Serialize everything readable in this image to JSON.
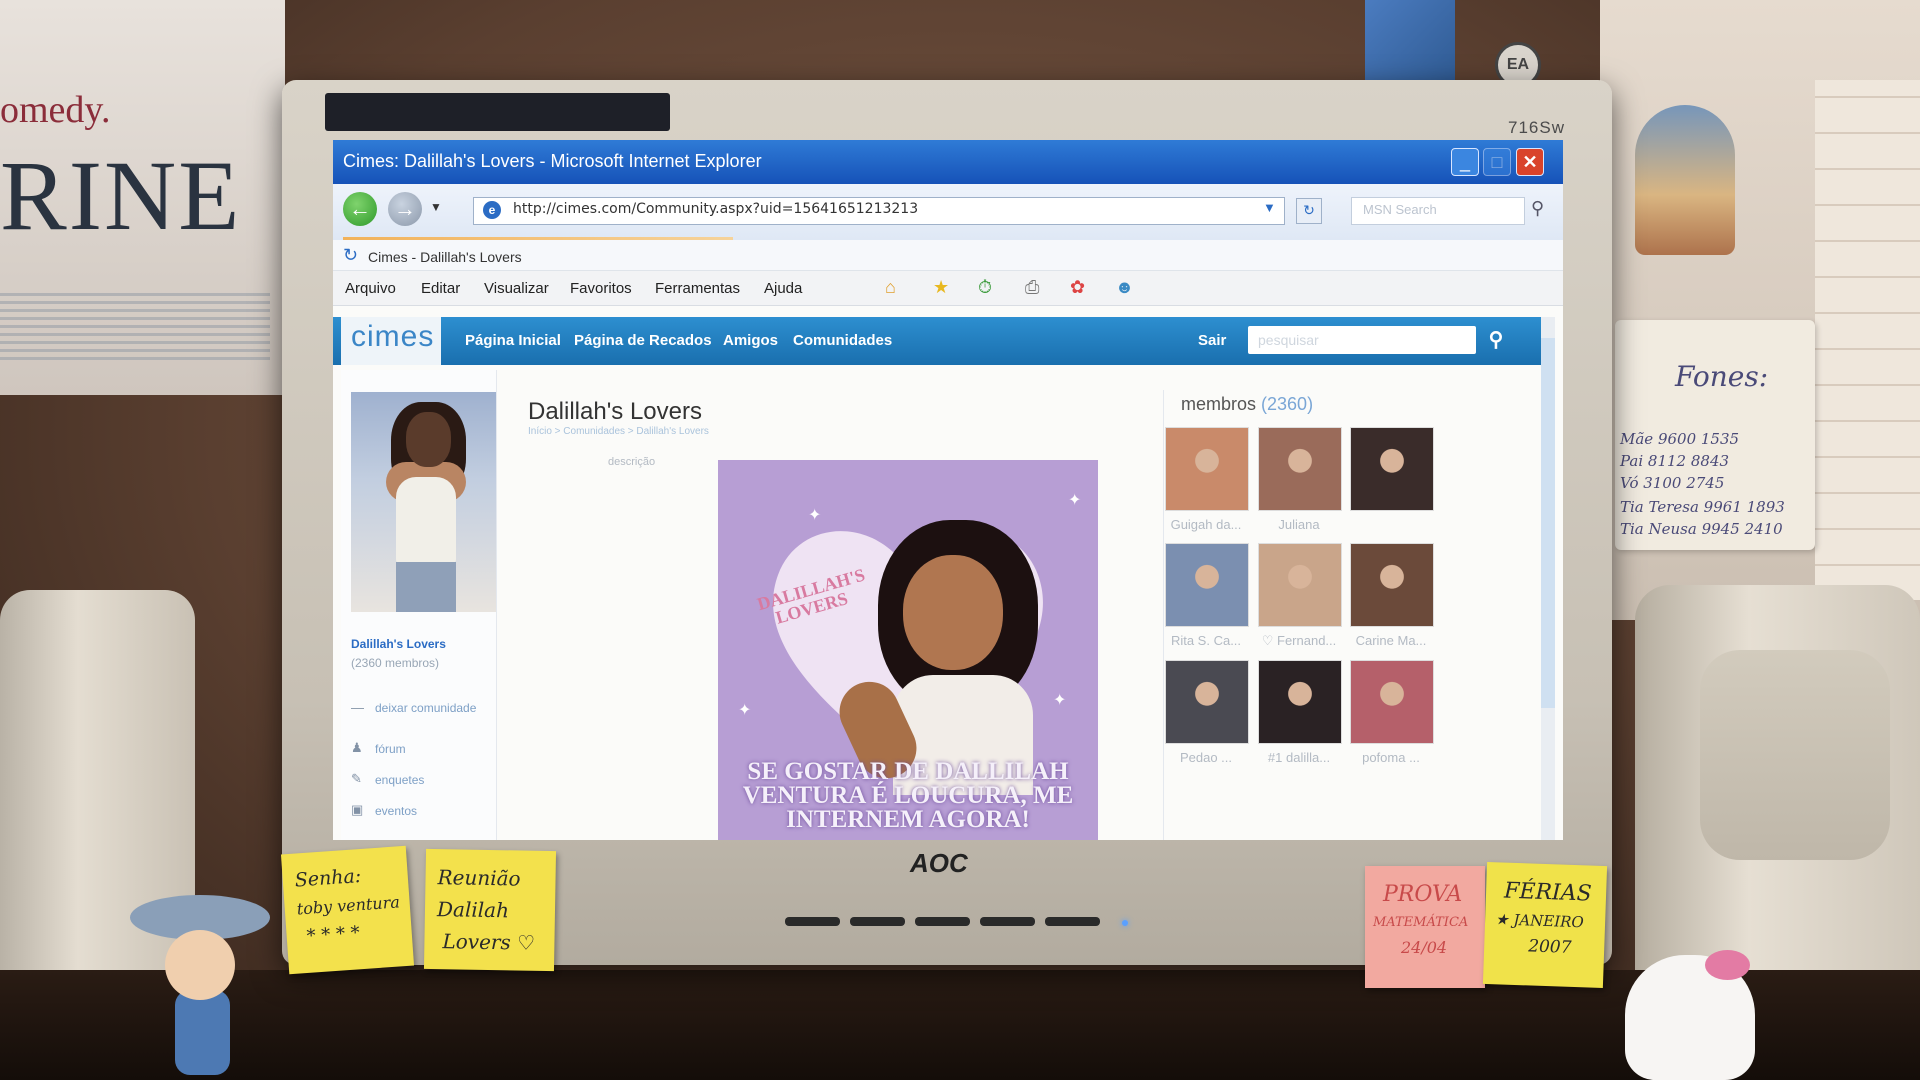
{
  "scene": {
    "poster_left": {
      "line1": "omedy.",
      "line2": "RINE"
    },
    "phone_card": {
      "title": "Fones:",
      "lines": [
        "Mãe 9600 1535",
        "Pai 8112 8843",
        "Vó 3100 2745",
        "Tia Teresa 9961 1893",
        "Tia Neusa 9945 2410"
      ]
    },
    "ea_logo": "EA",
    "monitor_model": "716Sw",
    "monitor_brand": "AOC",
    "sticky_notes": [
      {
        "lines": [
          "Senha:",
          "toby ventura",
          "* * * *"
        ]
      },
      {
        "lines": [
          "Reunião",
          "Dalilah",
          "Lovers ♡"
        ]
      },
      {
        "lines": [
          "PROVA",
          "MATEMÁTICA",
          "24/04"
        ]
      },
      {
        "lines": [
          "FÉRIAS",
          "★ JANEIRO",
          "2007"
        ]
      }
    ]
  },
  "browser": {
    "window_title": "Cimes: Dalillah's Lovers - Microsoft Internet Explorer",
    "url": "http://cimes.com/Community.aspx?uid=15641651213213",
    "search_placeholder": "MSN Search",
    "tab_title": "Cimes - Dalillah's Lovers",
    "menu": [
      "Arquivo",
      "Editar",
      "Visualizar",
      "Favoritos",
      "Ferramentas",
      "Ajuda"
    ],
    "window_buttons": {
      "minimize": "_",
      "maximize": "□",
      "close": "✕"
    }
  },
  "site": {
    "logo": "cimes",
    "nav": [
      "Página Inicial",
      "Página de Recados",
      "Amigos",
      "Comunidades"
    ],
    "logout": "Sair",
    "search_placeholder": "pesquisar",
    "community": {
      "name": "Dalillah's Lovers",
      "title": "Dalillah's Lovers",
      "members_text": "(2360 membros)",
      "breadcrumb": "Início > Comunidades > Dalillah's Lovers",
      "description_label": "descrição",
      "leave_link": "deixar comunidade",
      "links": [
        "fórum",
        "enquetes",
        "eventos"
      ],
      "banner": {
        "small_text_line1": "DALILLAH'S",
        "small_text_line2": "LOVERS",
        "caption": "SE GOSTAR DE DALLILAH VENTURA É LOUCURA, ME INTERNEM AGORA!"
      }
    },
    "members": {
      "label": "membros",
      "count": "(2360)",
      "list": [
        {
          "name": "Guigah da..."
        },
        {
          "name": "Juliana"
        },
        {
          "name": ""
        },
        {
          "name": "Rita S. Ca..."
        },
        {
          "name": "♡ Fernand..."
        },
        {
          "name": "Carine Ma..."
        },
        {
          "name": "Pedao ..."
        },
        {
          "name": "#1 dalilla..."
        },
        {
          "name": "pofoma ..."
        }
      ],
      "thumb_colors": [
        "#c98a6a",
        "#9a6b5a",
        "#3a2c2a",
        "#7b8fb0",
        "#c9a58a",
        "#6b4a3a",
        "#4a4a52",
        "#2a2224",
        "#b5606a"
      ]
    }
  },
  "colors": {
    "ie_titlebar": "#1652b8",
    "cimes_blue": "#2d8fd0",
    "link_blue": "#2b6cc4"
  }
}
